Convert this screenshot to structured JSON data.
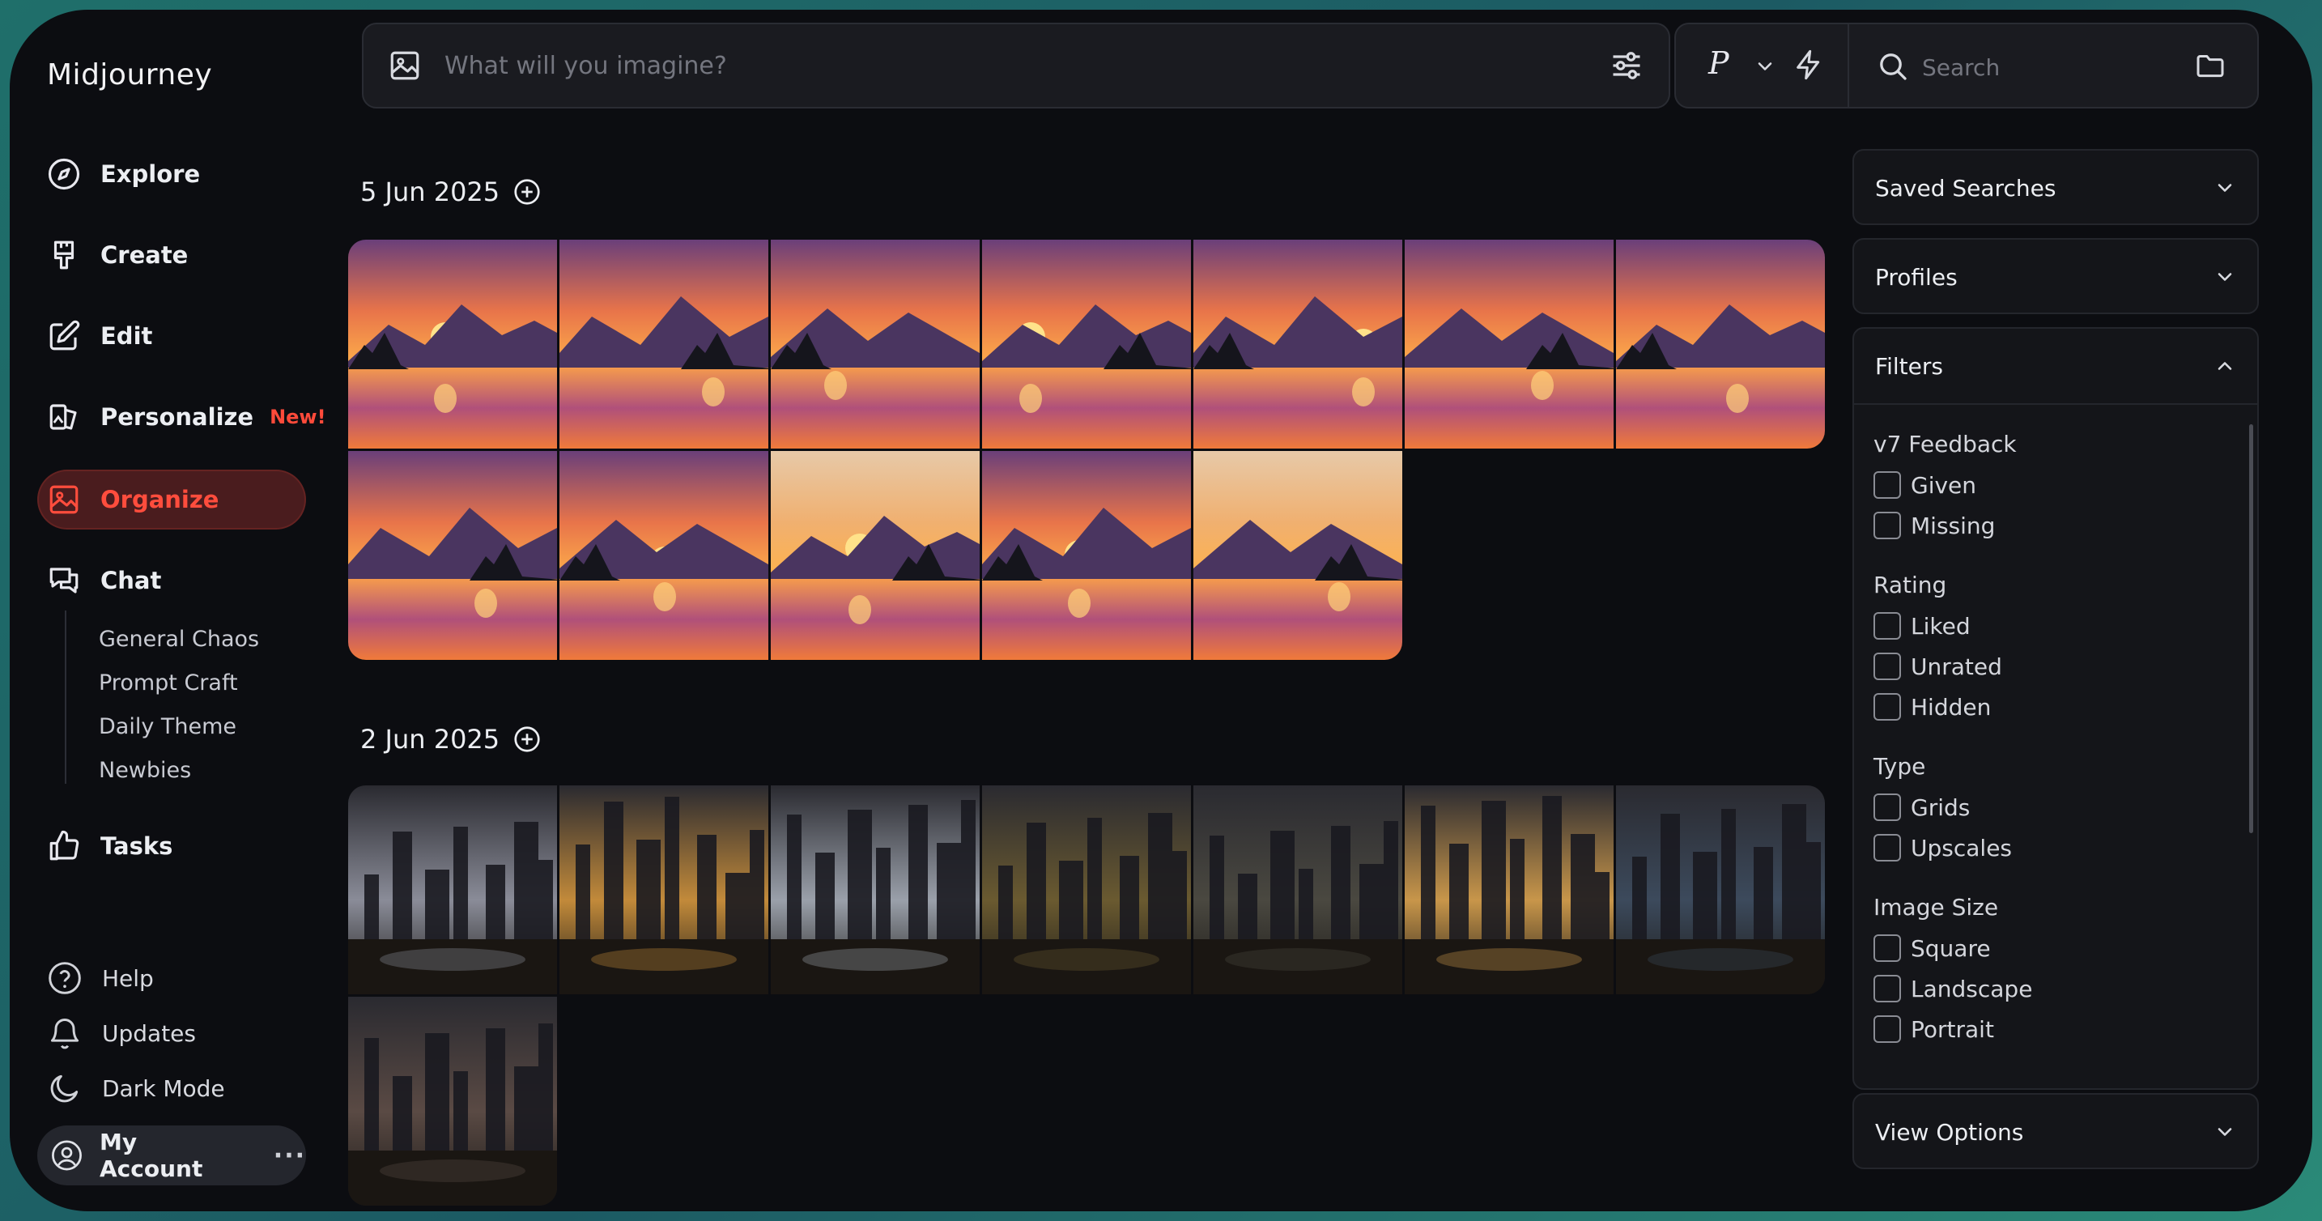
{
  "app": {
    "title": "Midjourney"
  },
  "nav": {
    "explore": "Explore",
    "create": "Create",
    "edit": "Edit",
    "personalize": "Personalize",
    "personalize_badge": "New!",
    "organize": "Organize",
    "chat": "Chat",
    "tasks": "Tasks"
  },
  "chat_channels": [
    "General Chaos",
    "Prompt Craft",
    "Daily Theme",
    "Newbies"
  ],
  "bottom_nav": {
    "help": "Help",
    "updates": "Updates",
    "dark_mode": "Dark Mode",
    "account": "My Account",
    "account_more": "···"
  },
  "prompt": {
    "placeholder": "What will you imagine?"
  },
  "toolbar": {
    "profile_letter": "P",
    "search_placeholder": "Search"
  },
  "groups": [
    {
      "date": "5 Jun 2025",
      "image_count": 12,
      "theme": "mountain lake sunset"
    },
    {
      "date": "2 Jun 2025",
      "image_count": 8,
      "theme": "ruined city at dusk"
    }
  ],
  "right_panel": {
    "saved_searches": "Saved Searches",
    "profiles": "Profiles",
    "filters": "Filters",
    "view_options": "View Options",
    "filter_groups": [
      {
        "label": "v7 Feedback",
        "options": [
          "Given",
          "Missing"
        ]
      },
      {
        "label": "Rating",
        "options": [
          "Liked",
          "Unrated",
          "Hidden"
        ]
      },
      {
        "label": "Type",
        "options": [
          "Grids",
          "Upscales"
        ]
      },
      {
        "label": "Image Size",
        "options": [
          "Square",
          "Landscape",
          "Portrait"
        ]
      }
    ]
  },
  "colors": {
    "accent": "#ff4d3d",
    "active_bg": "#4a1c1e",
    "background": "#0c0d11",
    "panel": "#141519"
  }
}
